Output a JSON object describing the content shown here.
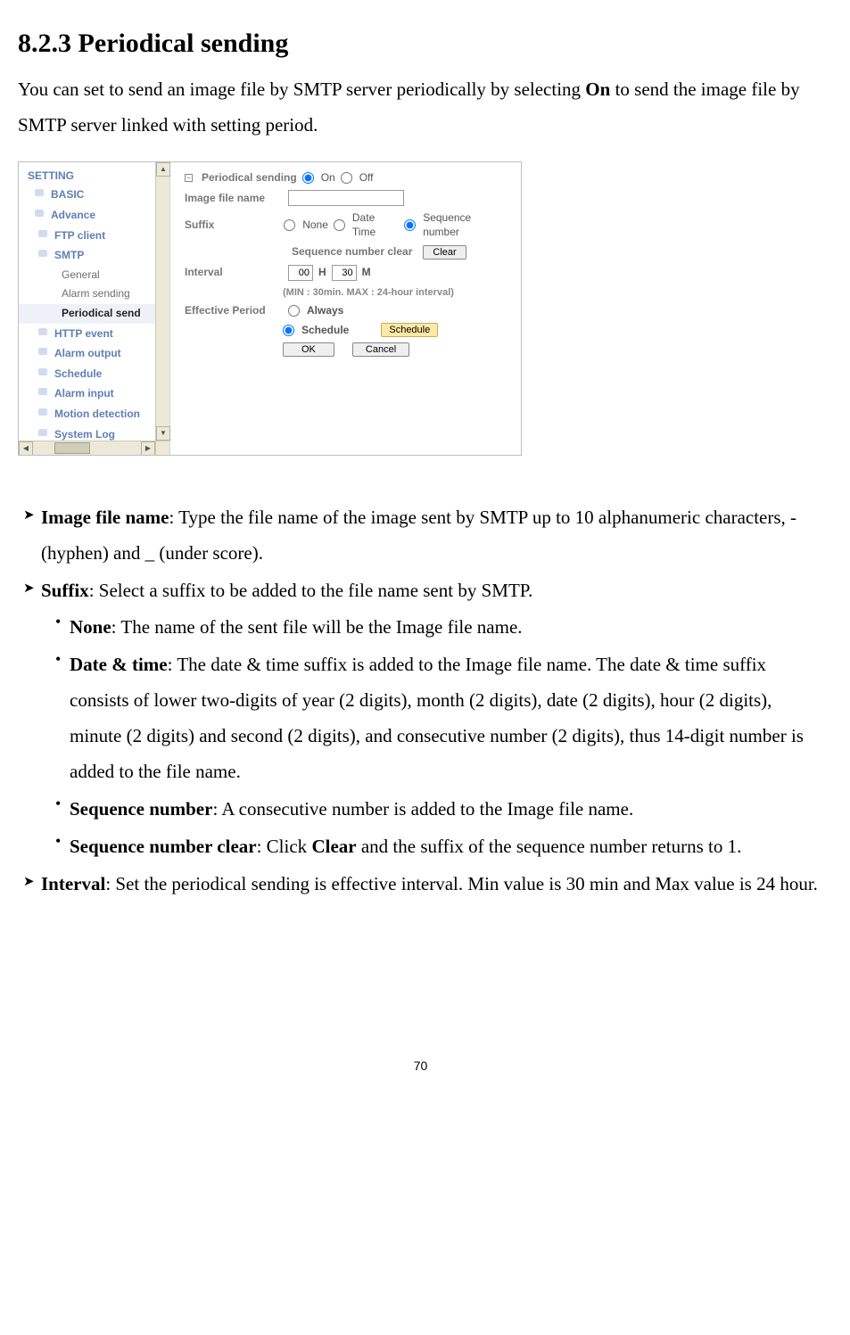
{
  "heading": "8.2.3 Periodical sending",
  "intro_1": "You can set to send an image file by SMTP server periodically by selecting ",
  "intro_on": "On",
  "intro_2": " to send the image file by SMTP server linked with setting period.",
  "sidebar": {
    "head": "SETTING",
    "basic": "BASIC",
    "advance": "Advance",
    "ftp": "FTP client",
    "smtp": "SMTP",
    "general": "General",
    "alarm_sending": "Alarm sending",
    "periodical_send": "Periodical send",
    "http_event": "HTTP event",
    "alarm_output": "Alarm output",
    "schedule": "Schedule",
    "alarm_input": "Alarm input",
    "motion": "Motion detection",
    "syslog": "System Log"
  },
  "form": {
    "periodical_sending": "Periodical sending",
    "on": "On",
    "off": "Off",
    "image_file_name": "Image file name",
    "suffix": "Suffix",
    "none": "None",
    "date_time": "Date Time",
    "sequence_number": "Sequence number",
    "seq_clear_label": "Sequence number clear",
    "clear": "Clear",
    "interval": "Interval",
    "h_val": "00",
    "h": "H",
    "m_val": "30",
    "m": "M",
    "interval_hint": "(MIN : 30min. MAX : 24-hour interval)",
    "effective_period": "Effective Period",
    "always": "Always",
    "schedule": "Schedule",
    "schedule_btn": "Schedule",
    "ok": "OK",
    "cancel": "Cancel"
  },
  "bul": {
    "ifn_b": "Image file name",
    "ifn_t": ": Type the file name of the image sent by SMTP up to 10 alphanumeric characters, - (hyphen) and _ (under score).",
    "suf_b": "Suffix",
    "suf_t": ": Select a suffix to be added to the file name sent by SMTP.",
    "none_b": "None",
    "none_t": ": The name of the sent file will be the Image file name.",
    "dt_b": "Date & time",
    "dt_t": ": The date & time suffix is added to the Image file name. The date & time suffix consists of lower two-digits of year (2 digits), month (2 digits), date (2 digits), hour (2 digits), minute (2 digits) and second (2 digits), and consecutive number (2 digits), thus 14-digit number is added to the file name.",
    "sn_b": "Sequence number",
    "sn_t": ": A consecutive number is added to the Image file name.",
    "snc_b": "Sequence number clear",
    "snc_t1": ": Click ",
    "snc_clear": "Clear",
    "snc_t2": " and the suffix of the sequence number returns to 1.",
    "int_b": "Interval",
    "int_t": ": Set the periodical sending is effective interval. Min value is 30 min and Max value is 24 hour."
  },
  "page_number": "70"
}
